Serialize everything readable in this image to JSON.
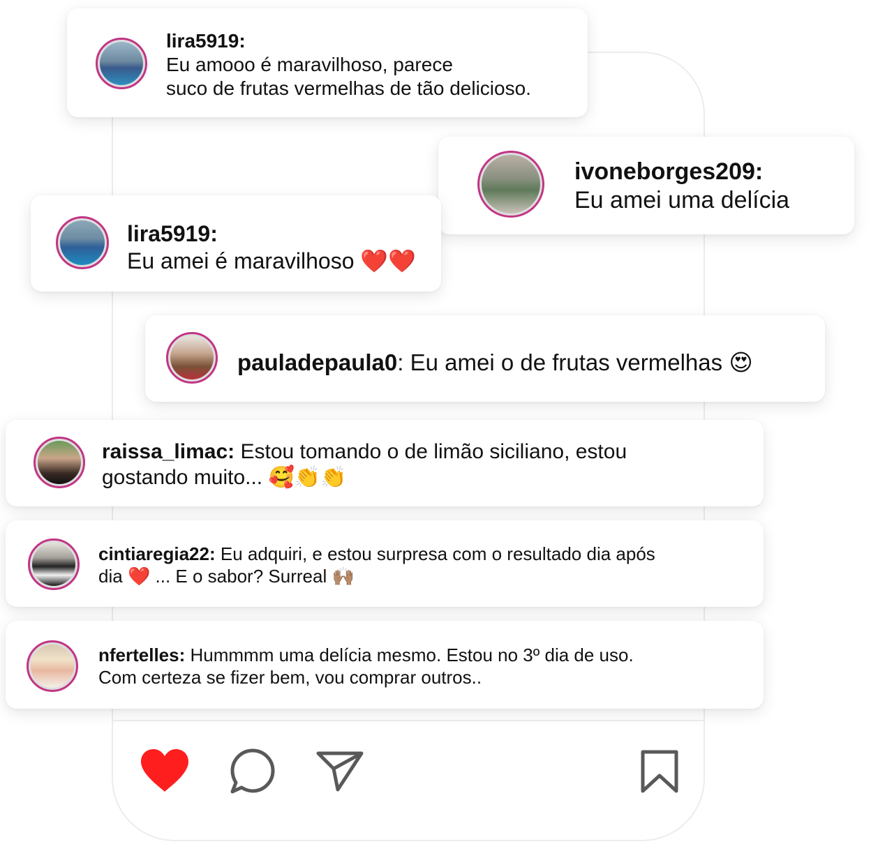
{
  "comments": [
    {
      "username": "lira5919:",
      "line1": "Eu amooo é maravilhoso, parece",
      "line2": "suco de frutas vermelhas de tão delicioso."
    },
    {
      "username": "ivoneborges209:",
      "line1": "Eu amei uma delícia"
    },
    {
      "username": "lira5919:",
      "line1": "Eu amei é maravilhoso",
      "emoji": "❤️❤️"
    },
    {
      "username": "pauladepaula0",
      "line1": ": Eu amei o de frutas vermelhas",
      "emoji": "😍"
    },
    {
      "username": "raissa_limac:",
      "line1": " Estou tomando o de limão siciliano, estou",
      "line2": "gostando muito...",
      "emoji": "🥰👏👏"
    },
    {
      "username": "cintiaregia22:",
      "line1": " Eu adquiri, e estou surpresa com o resultado dia após",
      "line2_a": "dia",
      "emoji_a": "❤️",
      "line2_b": " ... E o sabor? Surreal",
      "emoji_b": "🙌🏽"
    },
    {
      "username": "nfertelles:",
      "line1": " Hummmm uma delícia mesmo. Estou no 3º dia de uso.",
      "line2": "Com certeza se fizer bem, vou comprar outros.."
    }
  ],
  "icons": {
    "like": "heart-icon",
    "comment": "comment-bubble-icon",
    "share": "send-icon",
    "save": "bookmark-icon"
  },
  "colors": {
    "heart": "#fe1e1e",
    "avatar_ring": "#c13584",
    "icon_gray": "#595959"
  }
}
